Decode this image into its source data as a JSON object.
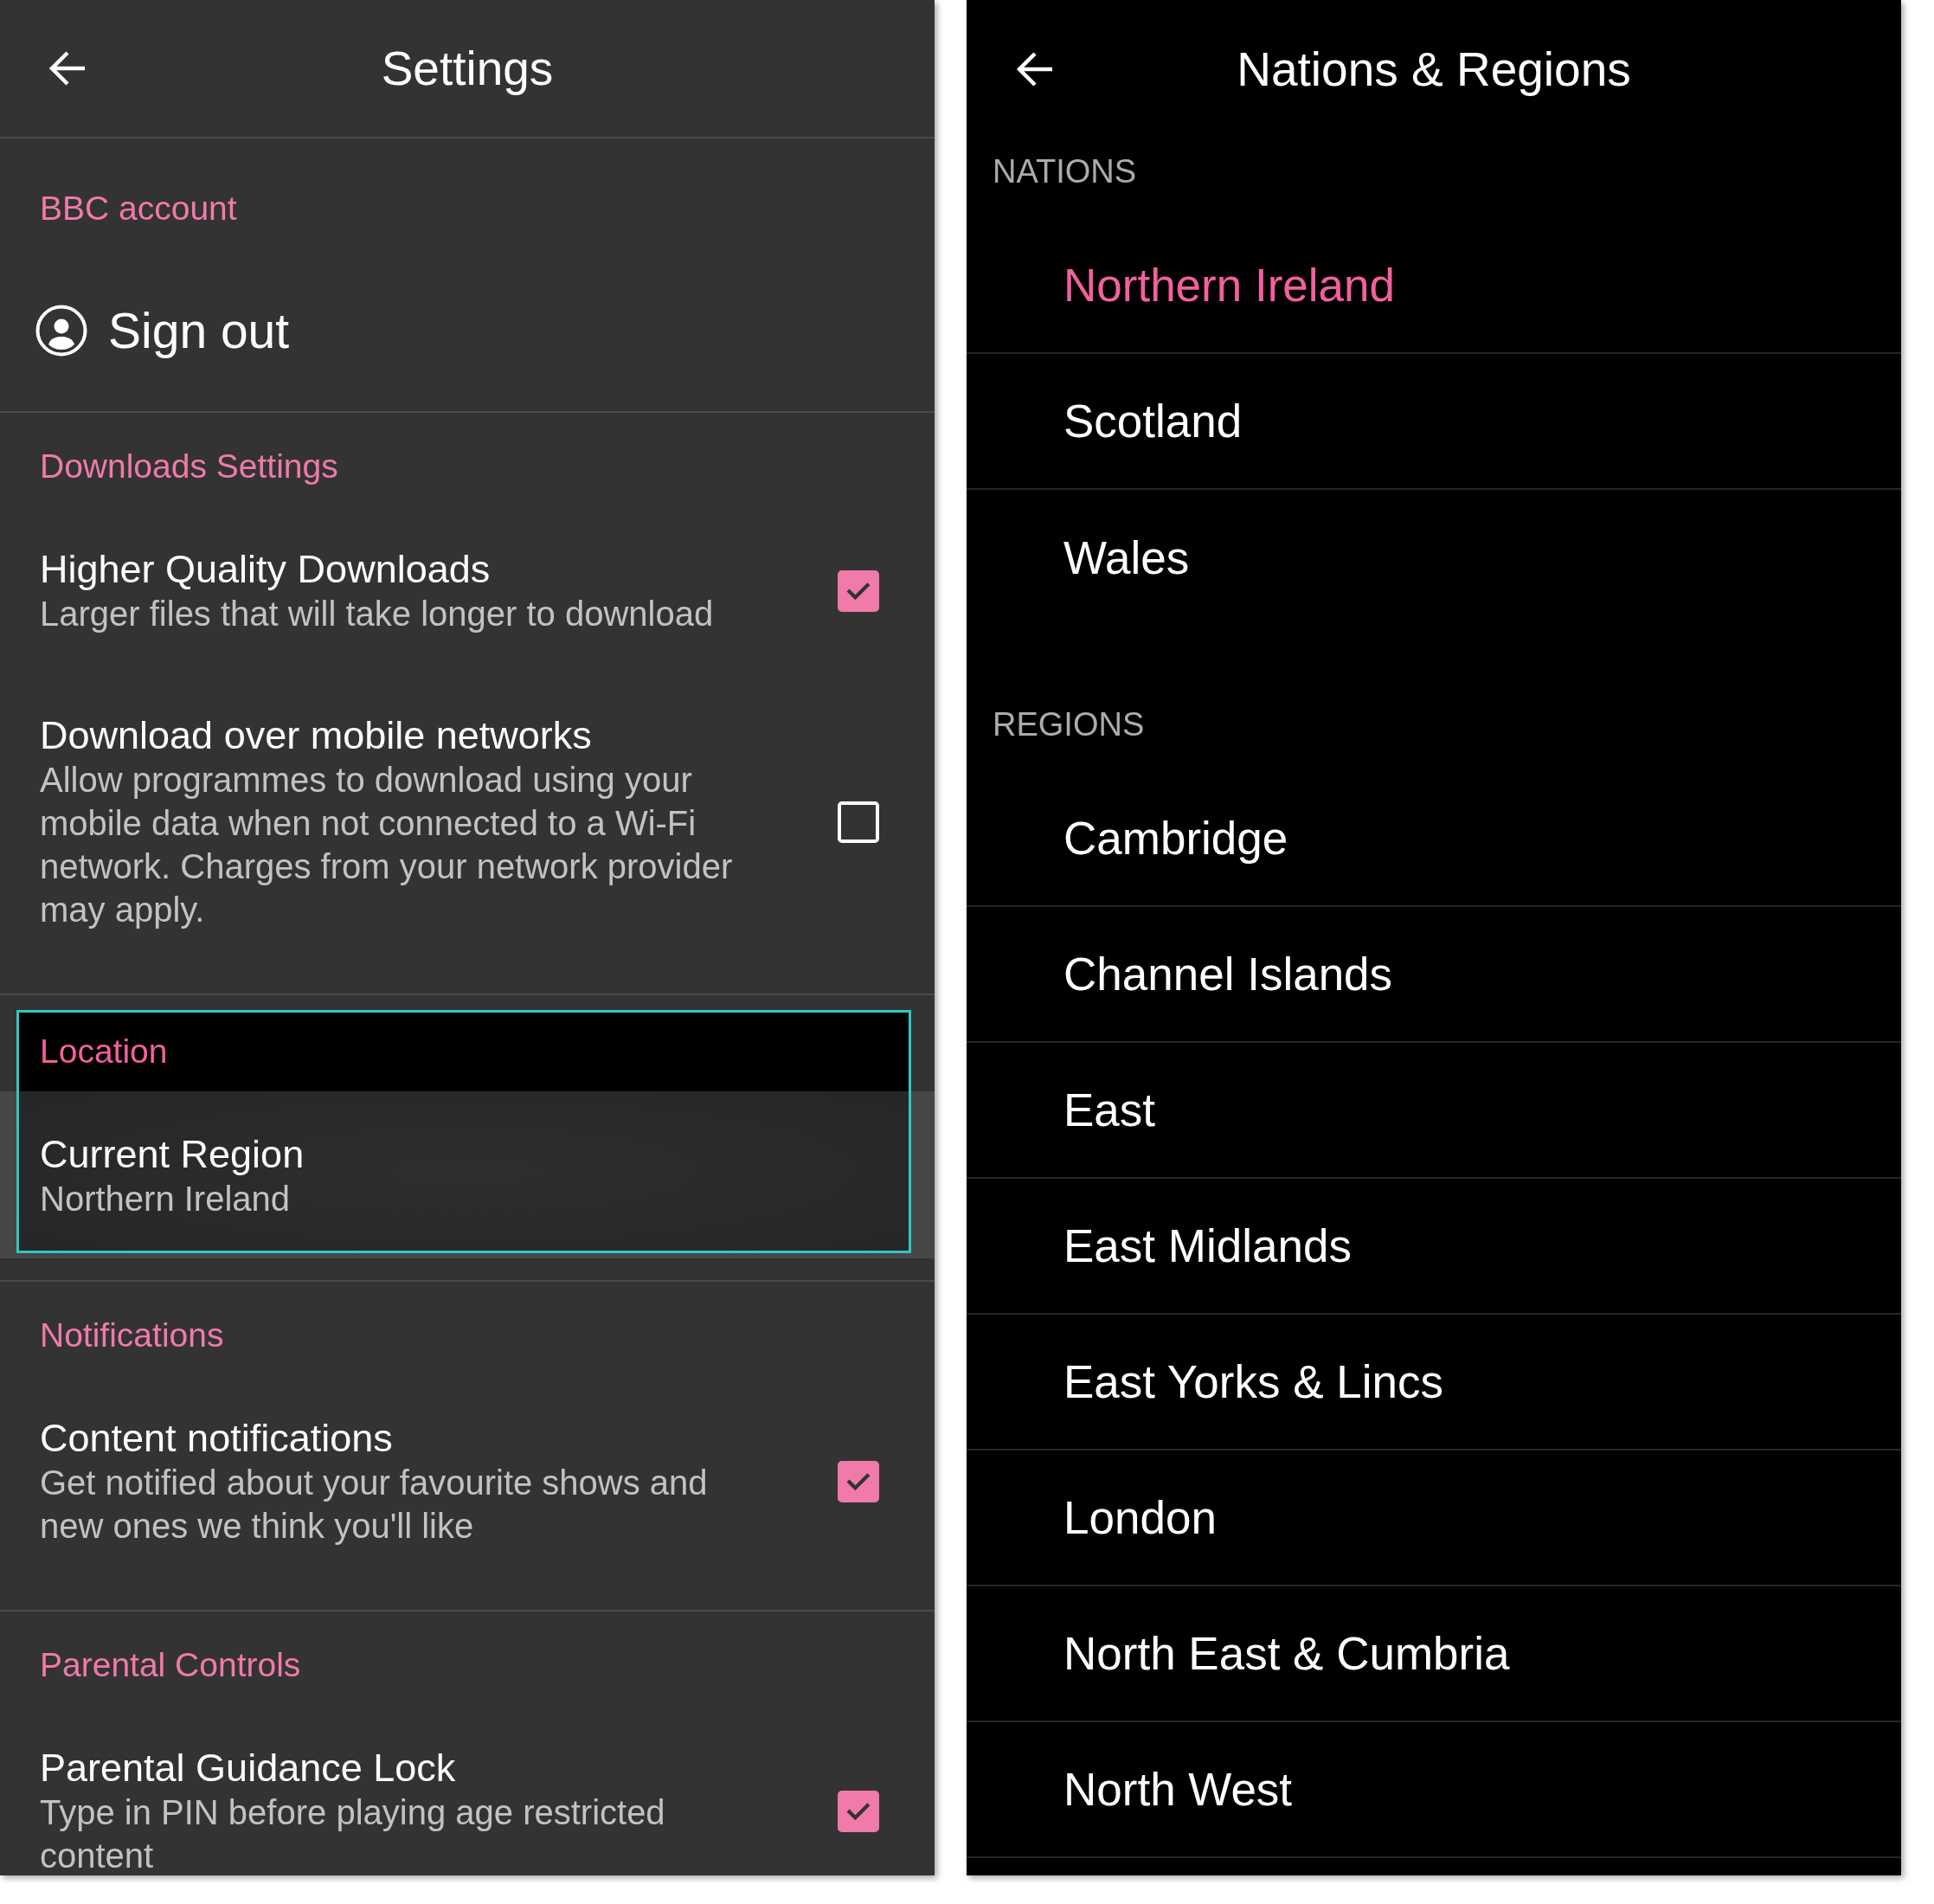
{
  "settings": {
    "title": "Settings",
    "sections": [
      {
        "heading": "BBC account",
        "focused": false,
        "items": [
          {
            "kind": "action",
            "label": "Sign out"
          }
        ]
      },
      {
        "heading": "Downloads Settings",
        "focused": false,
        "items": [
          {
            "kind": "checkbox",
            "label": "Higher Quality Downloads",
            "description": "Larger files that will take longer to download",
            "checked": true
          },
          {
            "kind": "checkbox",
            "label": "Download over mobile networks",
            "description": "Allow programmes to download using your mobile data when not connected to a Wi-Fi network. Charges from your network provider may apply.",
            "checked": false
          }
        ]
      },
      {
        "heading": "Location",
        "focused": true,
        "items": [
          {
            "kind": "value",
            "label": "Current Region",
            "value": "Northern Ireland"
          }
        ]
      },
      {
        "heading": "Notifications",
        "focused": false,
        "items": [
          {
            "kind": "checkbox",
            "label": "Content notifications",
            "description": "Get notified about your favourite shows and new ones we think you'll like",
            "checked": true
          }
        ]
      },
      {
        "heading": "Parental Controls",
        "focused": false,
        "items": [
          {
            "kind": "checkbox",
            "label": "Parental Guidance Lock",
            "description": "Type in PIN before playing age restricted content",
            "checked": true
          }
        ]
      }
    ]
  },
  "nations_regions": {
    "title": "Nations & Regions",
    "groups": [
      {
        "heading": "NATIONS",
        "items": [
          {
            "label": "Northern Ireland",
            "selected": true
          },
          {
            "label": "Scotland",
            "selected": false
          },
          {
            "label": "Wales",
            "selected": false
          }
        ]
      },
      {
        "heading": "REGIONS",
        "items": [
          {
            "label": "Cambridge",
            "selected": false
          },
          {
            "label": "Channel Islands",
            "selected": false
          },
          {
            "label": "East",
            "selected": false
          },
          {
            "label": "East Midlands",
            "selected": false
          },
          {
            "label": "East Yorks & Lincs",
            "selected": false
          },
          {
            "label": "London",
            "selected": false
          },
          {
            "label": "North East & Cumbria",
            "selected": false
          },
          {
            "label": "North West",
            "selected": false
          }
        ]
      }
    ]
  }
}
